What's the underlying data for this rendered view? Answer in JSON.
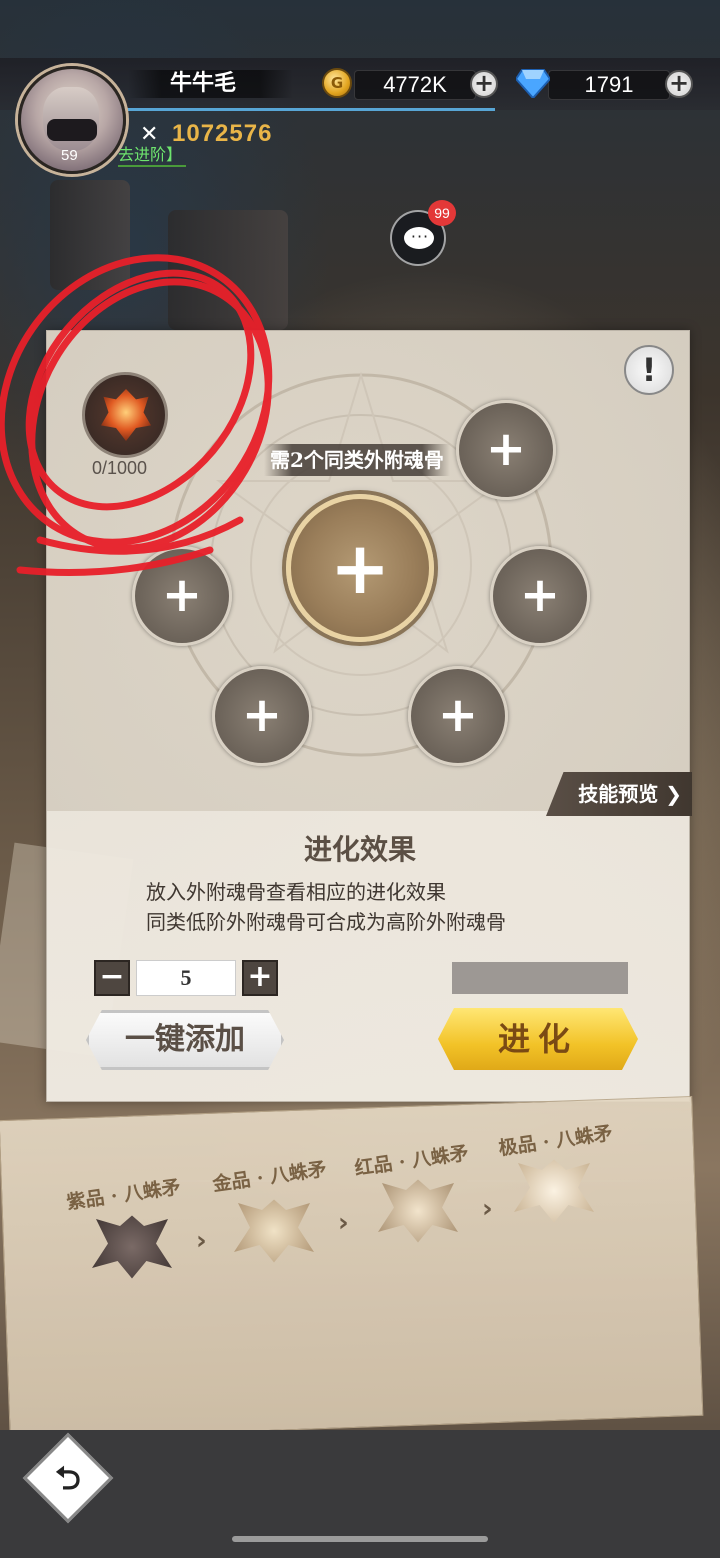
{
  "header": {
    "player_name": "牛牛毛",
    "level": "59",
    "gold": "4772K",
    "diamonds": "1791",
    "power": "1072576",
    "advance_link": "去进阶】"
  },
  "chat": {
    "badge_count": "99"
  },
  "panel": {
    "info_symbol": "!",
    "material_count": "0/1000",
    "requirement_label": "需2个同类外附魂骨",
    "plus": "+",
    "skill_preview": "技能预览",
    "effect_title": "进化效果",
    "effect_lines": [
      "放入外附魂骨查看相应的进化效果",
      "同类低阶外附魂骨可合成为高阶外附魂骨"
    ],
    "stepper": {
      "minus": "−",
      "value": "5",
      "plus": "+"
    },
    "one_click_add": "一键添加",
    "evolve": "进化"
  },
  "stages": [
    "紫品 · 八蛛矛",
    "金品 · 八蛛矛",
    "红品 · 八蛛矛",
    "极品 · 八蛛矛"
  ],
  "colors": {
    "accent_gold": "#f2c227",
    "badge_red": "#e33838",
    "annotation_red": "#e8202a"
  }
}
